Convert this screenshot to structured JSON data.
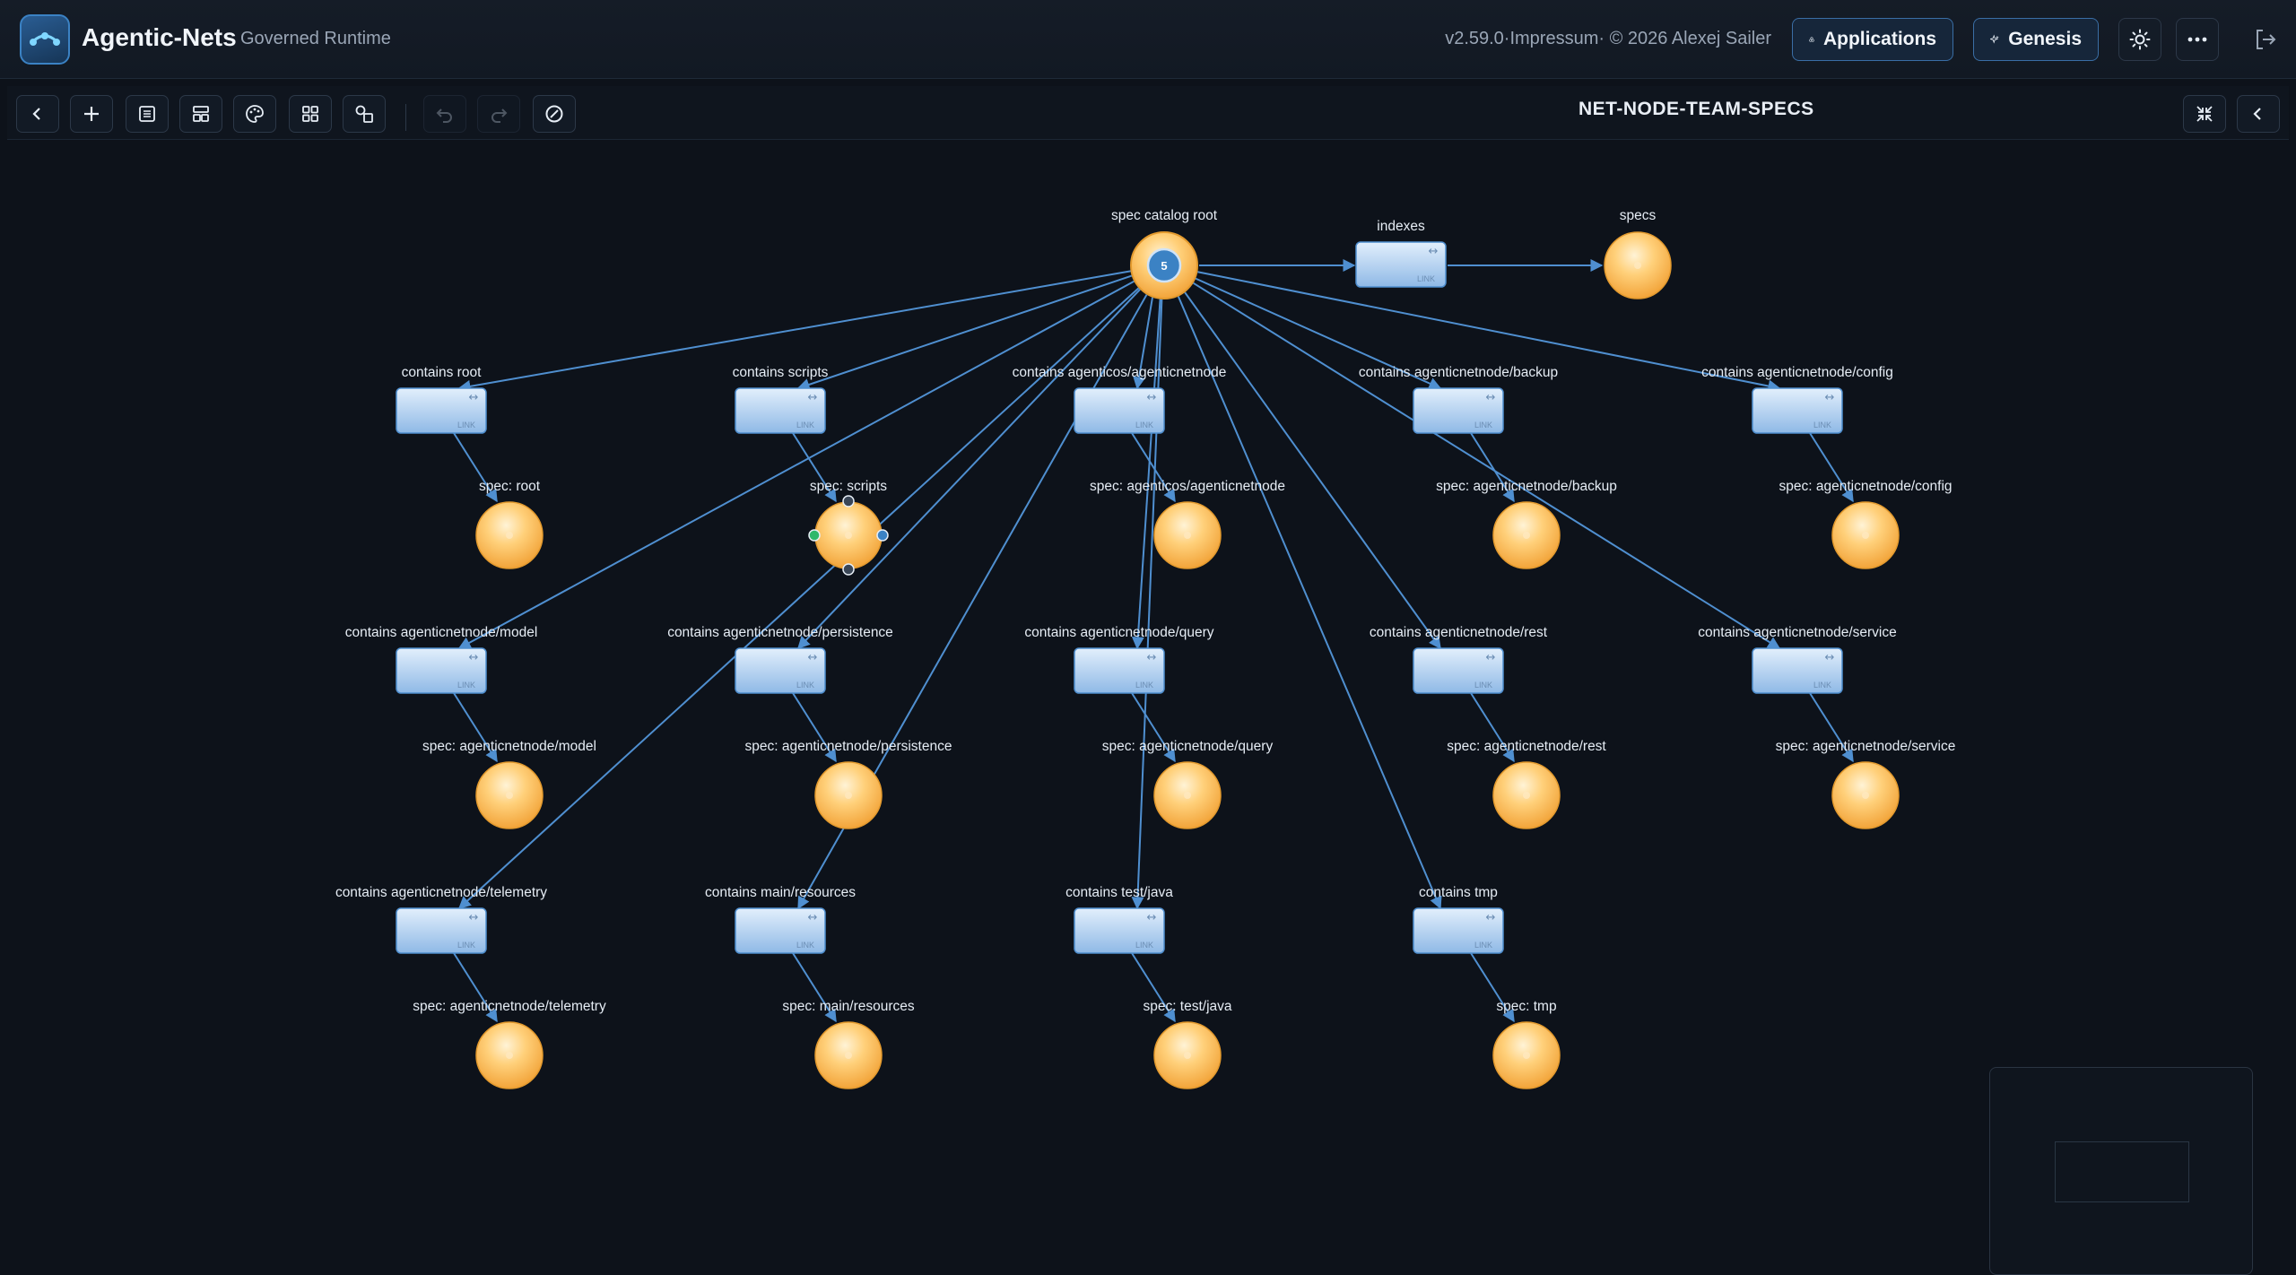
{
  "app": {
    "title": "Agentic-Nets",
    "subtitle": "Governed Runtime",
    "version": "v2.59.0·Impressum· © 2026 Alexej Sailer",
    "applications_label": "Applications",
    "genesis_label": "Genesis"
  },
  "toolbar": {
    "net_title": "NET-NODE-TEAM-SPECS",
    "items": [
      "back-icon",
      "add-icon",
      "list-icon",
      "layout-icon",
      "palette-icon",
      "grid-icon",
      "shapes-icon",
      "undo-icon",
      "redo-icon",
      "disable-icon"
    ]
  },
  "graph": {
    "root": {
      "label": "spec catalog root",
      "token_count": "5"
    },
    "indexes": {
      "label": "indexes",
      "tag": "LINK"
    },
    "specs": {
      "label": "specs"
    },
    "link_tag": "LINK",
    "transitions": [
      "contains root",
      "contains scripts",
      "contains agenticos/agenticnetnode",
      "contains agenticnetnode/backup",
      "contains agenticnetnode/config",
      "contains agenticnetnode/model",
      "contains agenticnetnode/persistence",
      "contains agenticnetnode/query",
      "contains agenticnetnode/rest",
      "contains agenticnetnode/service",
      "contains agenticnetnode/telemetry",
      "contains main/resources",
      "contains test/java",
      "contains tmp"
    ],
    "places": [
      "spec: root",
      "spec: scripts",
      "spec: agenticos/agenticnetnode",
      "spec: agenticnetnode/backup",
      "spec: agenticnetnode/config",
      "spec: agenticnetnode/model",
      "spec: agenticnetnode/persistence",
      "spec: agenticnetnode/query",
      "spec: agenticnetnode/rest",
      "spec: agenticnetnode/service",
      "spec: agenticnetnode/telemetry",
      "spec: main/resources",
      "spec: test/java",
      "spec: tmp"
    ]
  },
  "colors": {
    "accent": "#3b82c4",
    "edge": "#4f8fd0",
    "place": "#f7b545",
    "transition": "#9cc3ea"
  }
}
